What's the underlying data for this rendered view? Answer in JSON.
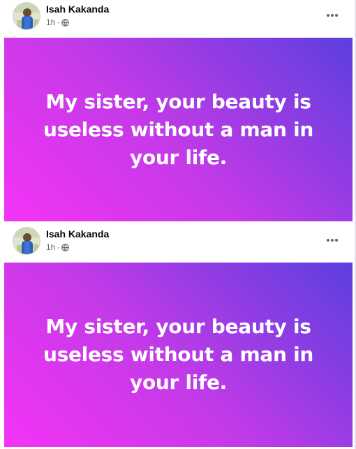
{
  "posts": [
    {
      "author": "Isah Kakanda",
      "time": "1h",
      "separator": "·",
      "privacy_icon": "globe-icon",
      "more_icon": "more-options-icon",
      "text": "My sister, your beauty is useless without a man in your life."
    },
    {
      "author": "Isah Kakanda",
      "time": "1h",
      "separator": "·",
      "privacy_icon": "globe-icon",
      "more_icon": "more-options-icon",
      "text": "My sister, your beauty is useless without a man in your life."
    }
  ],
  "colors": {
    "gradient_start": "#f533f6",
    "gradient_mid": "#c43ae8",
    "gradient_end": "#5b3fdf",
    "post_text": "#ffffff",
    "author_text": "#050505",
    "meta_text": "#65676b"
  }
}
